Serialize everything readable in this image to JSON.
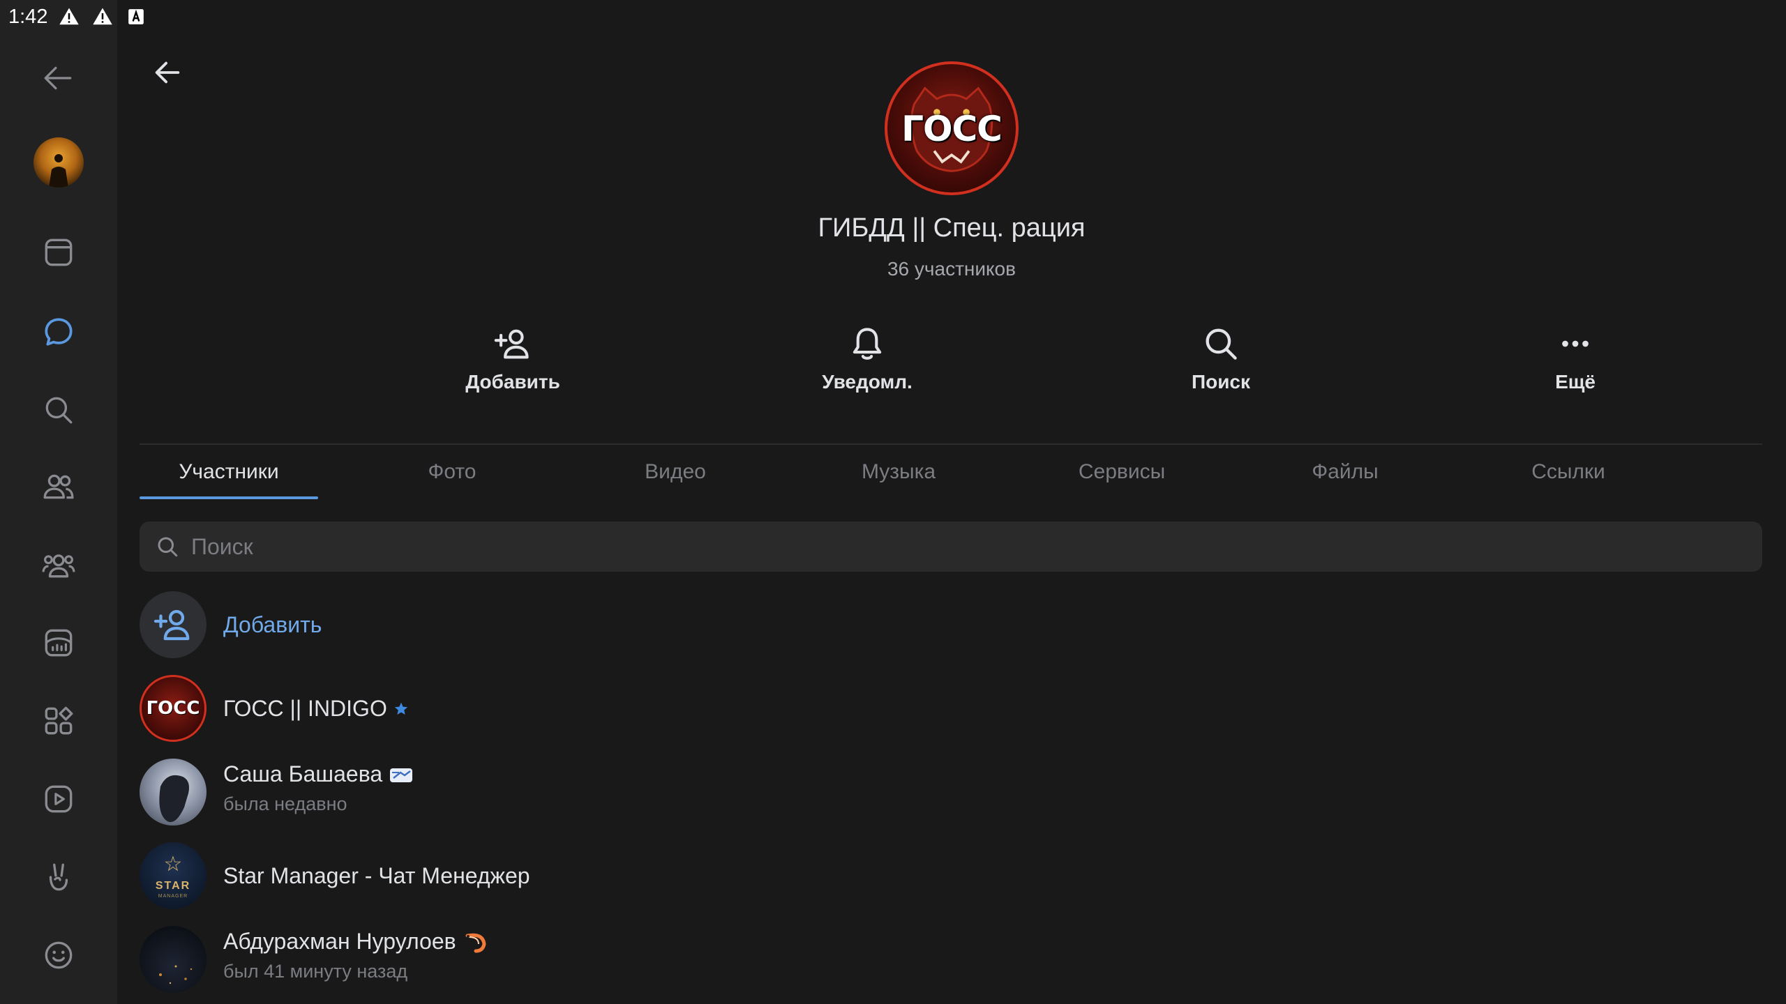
{
  "status_bar": {
    "time": "1:42"
  },
  "group": {
    "logo_text": "ГОСС",
    "title": "ГИБДД || Спец. рация",
    "subtitle": "36 участников"
  },
  "actions": [
    {
      "label": "Добавить",
      "icon": "add-user-icon"
    },
    {
      "label": "Уведомл.",
      "icon": "bell-icon"
    },
    {
      "label": "Поиск",
      "icon": "search-icon"
    },
    {
      "label": "Ещё",
      "icon": "more-icon"
    }
  ],
  "tabs": [
    {
      "label": "Участники",
      "active": true
    },
    {
      "label": "Фото",
      "active": false
    },
    {
      "label": "Видео",
      "active": false
    },
    {
      "label": "Музыка",
      "active": false
    },
    {
      "label": "Сервисы",
      "active": false
    },
    {
      "label": "Файлы",
      "active": false
    },
    {
      "label": "Ссылки",
      "active": false
    }
  ],
  "search": {
    "placeholder": "Поиск"
  },
  "members": {
    "add_label": "Добавить",
    "items": [
      {
        "name": "ГОСС || INDIGO",
        "status": "",
        "avatar_text": "ГОСС"
      },
      {
        "name": "Саша Башаева",
        "status": "была недавно"
      },
      {
        "name": "Star Manager - Чат Менеджер",
        "status": "",
        "avatar_text": "STAR",
        "avatar_sub": "MANAGER"
      },
      {
        "name": "Абдурахман Нурулоев",
        "status": "был 41 минуту назад"
      }
    ]
  },
  "colors": {
    "accent": "#71aaeb",
    "tab_underline": "#5a98e0",
    "background": "#191919",
    "rail": "#222222"
  }
}
